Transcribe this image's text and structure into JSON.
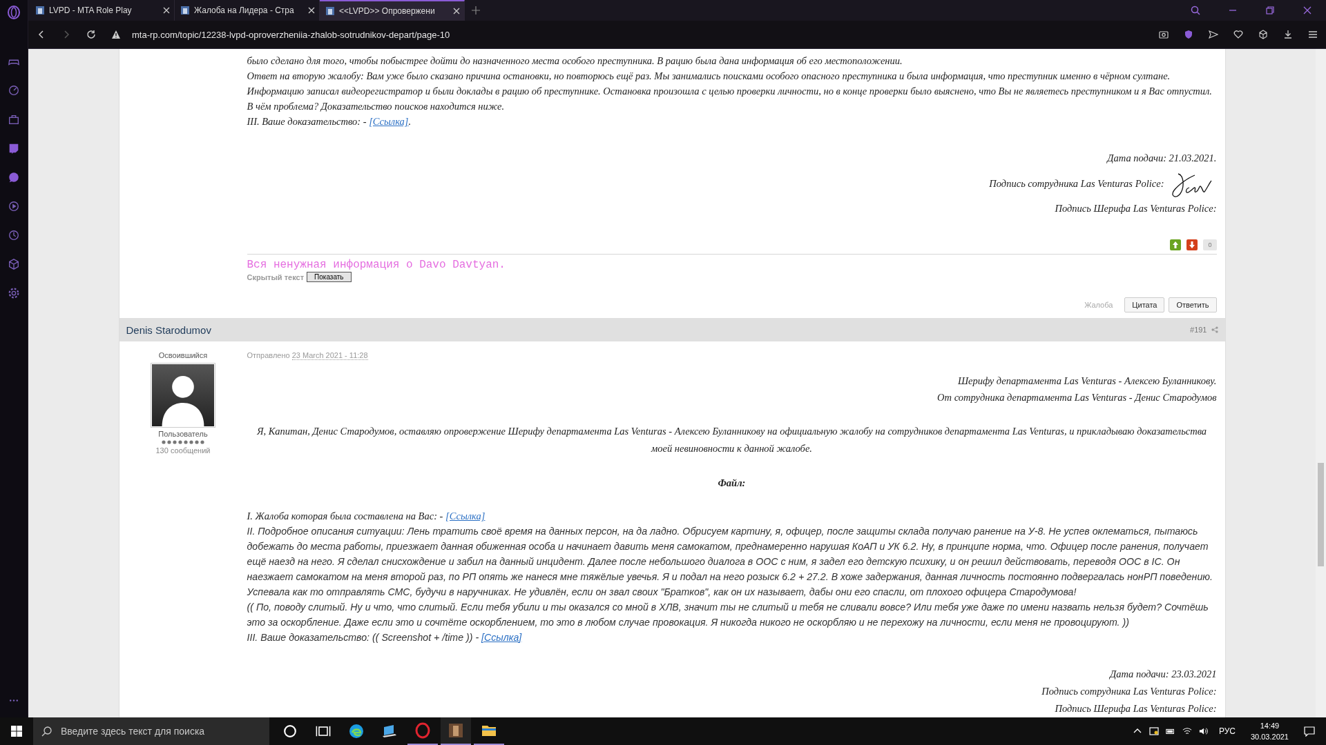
{
  "browser": {
    "tabs": [
      {
        "title": "LVPD - MTA Role Play",
        "selected": false
      },
      {
        "title": "Жалоба на Лидера - Стра",
        "selected": false
      },
      {
        "title": "<<LVPD>> Опровержени",
        "selected": true
      }
    ],
    "url": "mta-rp.com/topic/12238-lvpd-oproverzheniia-zhalob-sotrudnikov-depart/page-10"
  },
  "posts": [
    {
      "items": [
        {
          "kind": "serif",
          "text": "было сделано для того, чтобы побыстрее дойти до назначенного места особого преступника. В рацию была дана информация об его местоположении."
        },
        {
          "kind": "serif",
          "text": "Ответ на вторую жалобу: Вам уже было сказано причина остановки, но повторюсь ещё раз. Мы занимались поисками особого опасного преступника и была информация, что преступник именно в  чёрном султане. Информацию записал видеорегистратор и были доклады в рацию об преступнике. Остановка произошла с целью проверки личности, но в конце проверки было выяснено, что Вы не являетесь преступником и я Вас отпустил. В чём проблема? Доказательство поисков находится ниже."
        },
        {
          "kind": "serif",
          "text": "III. Ваше доказательство:  - ",
          "link": "[Ссылка]",
          "after": "."
        }
      ],
      "footer": [
        {
          "text": "Дата подачи: 21.03.2021.",
          "signature": false
        },
        {
          "text": "Подпись сотрудника Las Venturas Police:",
          "signature": true
        },
        {
          "text": "Подпись Шерифа Las Venturas Police:",
          "signature": false
        }
      ],
      "rating": "0",
      "hidden": {
        "text": "Вся ненужная информация о Davo Davtyan.",
        "label": "Скрытый текст",
        "button": "Показать"
      },
      "actions": [
        {
          "label": "Жалоба",
          "disabled": true
        },
        {
          "label": "Цитата",
          "disabled": false
        },
        {
          "label": "Ответить",
          "disabled": false
        }
      ]
    },
    {
      "header": {
        "author": "Denis Starodumov",
        "number": "#191"
      },
      "user": {
        "title": "Освоившийся",
        "group": "Пользователь",
        "posts": "130 сообщений"
      },
      "meta": {
        "label": "Отправлено ",
        "date": "23 March 2021 - 11:28"
      },
      "address": [
        "Шерифу департамента Las Venturas - Алексею Буланникову.",
        "От сотрудника департамента Las Venturas - Денис Стародумов"
      ],
      "intro": "Я,  Капитан, Денис Стародумов, оставляю опровержение Шерифу департамента Las Venturas - Алексею Буланникову на официальную жалобу на сотрудников департамента Las Venturas, и прикладываю доказательства моей невиновности  к данной жалобе.",
      "file_heading": "Файл:",
      "items": [
        {
          "kind": "serif",
          "text": "I. Жалоба которая была составлена на Вас: - ",
          "link": "[Ссылка]"
        },
        {
          "kind": "sans",
          "text": "II. Подробное описания ситуации: Лень тратить своё время на данных персон, на да ладно. Обрисуем картину, я, офицер, после защиты склада получаю ранение на У-8. Не успев оклематься, пытаюсь добежать до места работы, приезжает данная обиженная особа и начинает давить меня самокатом, преднамеренно нарушая КоАП и УК 6.2. Ну, в принципе норма, что. Офицер после ранения, получает ещё наезд на него. Я сделал снисхождение и забил на данный инцидент. Далее после небольшого диалога в ООС с ним, я задел его детскую психику, и он решил действовать, переводя ООС в IC. Он наезжает самокатом на меня второй раз, по РП опять же нанеся мне тяжёлые увечья. Я и подал на него розыск 6.2 + 27.2. В хоже задержания, данная личность постоянно подвергалась нонРП поведению. Успевала как то отправлять СМС, будучи в наручниках. Не удивлён, если он звал своих \"Братков\", как он их называет, дабы они его спасли, от плохого офицера Стародумова!"
        },
        {
          "kind": "sans",
          "text": "(( По, поводу слитый. Ну и что, что слитый. Если тебя убили и ты оказался со мной в ХЛВ, значит ты не слитый и тебя не сливали вовсе? Или тебя уже даже по имени назвать нельзя будет? Сочтёшь это за оскорбление. Даже если это и сочтёте оскорблением, то это в любом случае провокация. Я никогда никого не оскорбляю и не перехожу на личности, если меня не провоцируют. ))"
        },
        {
          "kind": "sans",
          "text": "III. Ваше доказательство: (( Screenshot + /time )) - ",
          "link": "[Ссылка]"
        }
      ],
      "footer": [
        {
          "text": "Дата подачи: 23.03.2021",
          "signature": false
        },
        {
          "text": "Подпись сотрудника Las Venturas Police:",
          "signature": false
        },
        {
          "text": "Подпись Шерифа Las Venturas Police:",
          "signature": false
        }
      ]
    }
  ],
  "taskbar": {
    "search_placeholder": "Введите здесь текст для поиска",
    "language": "РУС",
    "time": "14:49",
    "date": "30.03.2021"
  }
}
